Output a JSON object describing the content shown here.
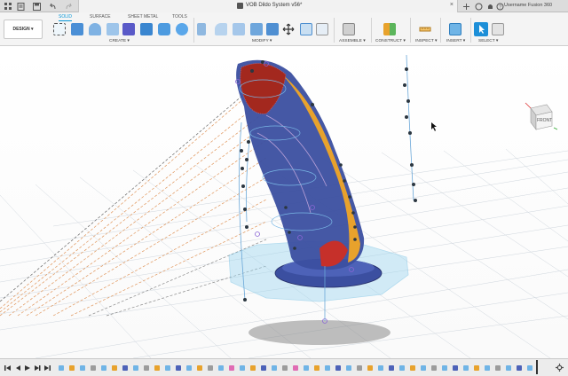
{
  "titlebar": {
    "document_title": "VOB Dildo System v56*",
    "username": "Username Fusion 360",
    "close_label": "×"
  },
  "toolbar": {
    "workspace_label": "DESIGN ▾",
    "tabs": [
      {
        "label": "SOLID",
        "active": true
      },
      {
        "label": "SURFACE",
        "active": false
      },
      {
        "label": "SHEET METAL",
        "active": false
      },
      {
        "label": "TOOLS",
        "active": false
      }
    ],
    "groups": [
      {
        "label": "CREATE ▾"
      },
      {
        "label": "MODIFY ▾"
      },
      {
        "label": "ASSEMBLE ▾"
      },
      {
        "label": "CONSTRUCT ▾"
      },
      {
        "label": "INSPECT ▾"
      },
      {
        "label": "INSERT ▾"
      },
      {
        "label": "SELECT ▾"
      }
    ]
  },
  "viewcube": {
    "face_label": "FRONT"
  },
  "colors": {
    "accent": "#0696d7",
    "grid": "#c8d0d8",
    "body_blue": "#3b4fa0",
    "body_orange": "#e8a22c",
    "sketch_blue": "#6aa7d8",
    "construction_orange": "#e0955a"
  }
}
